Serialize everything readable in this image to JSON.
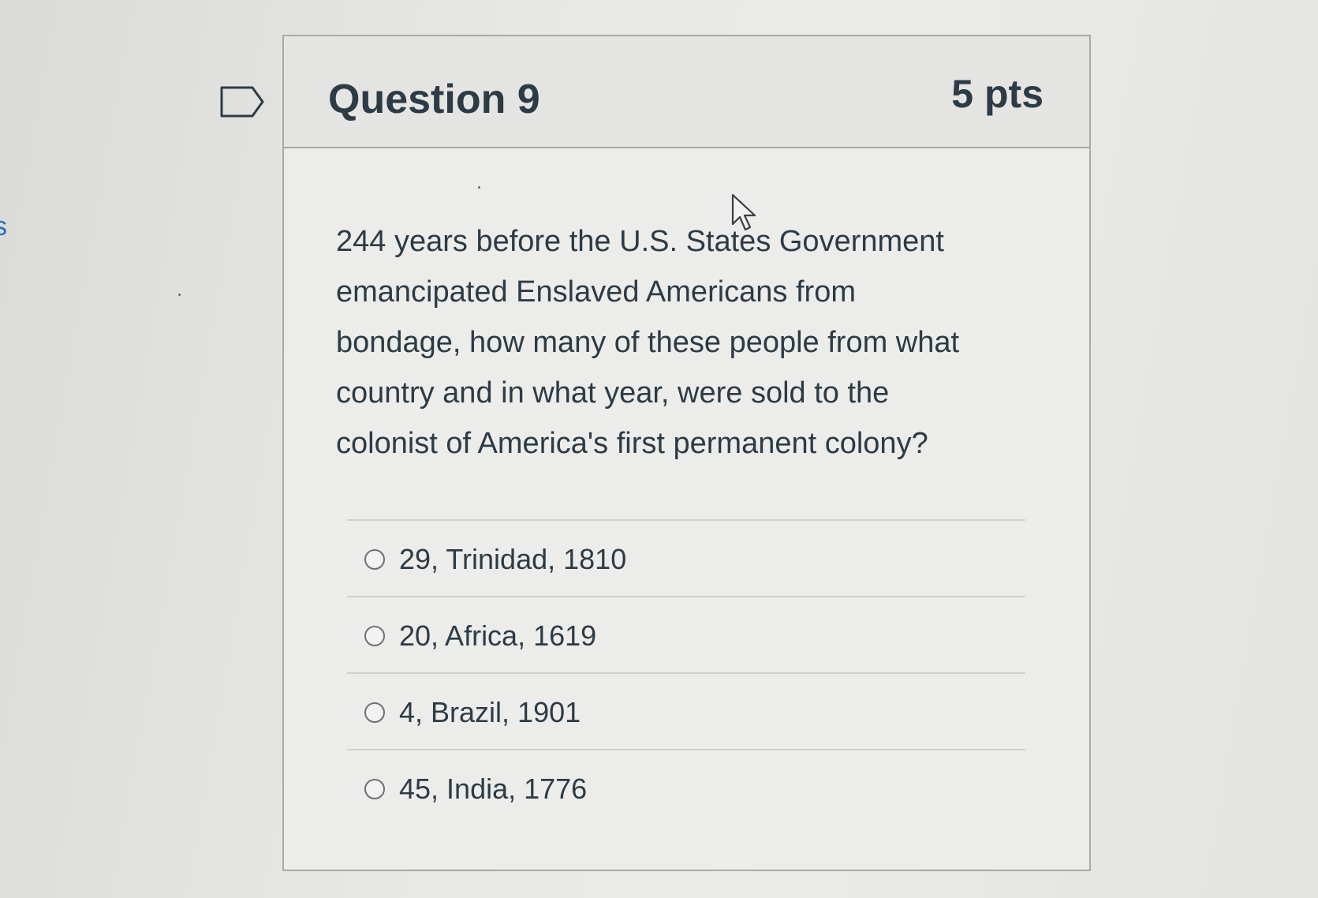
{
  "sidebar": {
    "fragment": "s"
  },
  "question": {
    "title": "Question 9",
    "points": "5 pts",
    "text_lines": [
      "244 years before the U.S. States Government",
      "emancipated Enslaved Americans from",
      "bondage, how many of these people from what",
      "country and in what year, were sold to the",
      "colonist of America's first permanent colony?"
    ],
    "answers": [
      {
        "label": "29, Trinidad, 1810",
        "selected": false
      },
      {
        "label": "20, Africa, 1619",
        "selected": false
      },
      {
        "label": "4, Brazil, 1901",
        "selected": false
      },
      {
        "label": "45, India, 1776",
        "selected": false
      }
    ]
  },
  "icons": {
    "flag": "flag-outline-icon",
    "radio": "radio-empty-icon",
    "cursor": "mouse-pointer-icon"
  },
  "colors": {
    "text": "#2d3b45",
    "link": "#2b6dbf",
    "border": "#a9aaa8",
    "header_bg": "#e4e4e2",
    "card_bg": "#ececea"
  }
}
